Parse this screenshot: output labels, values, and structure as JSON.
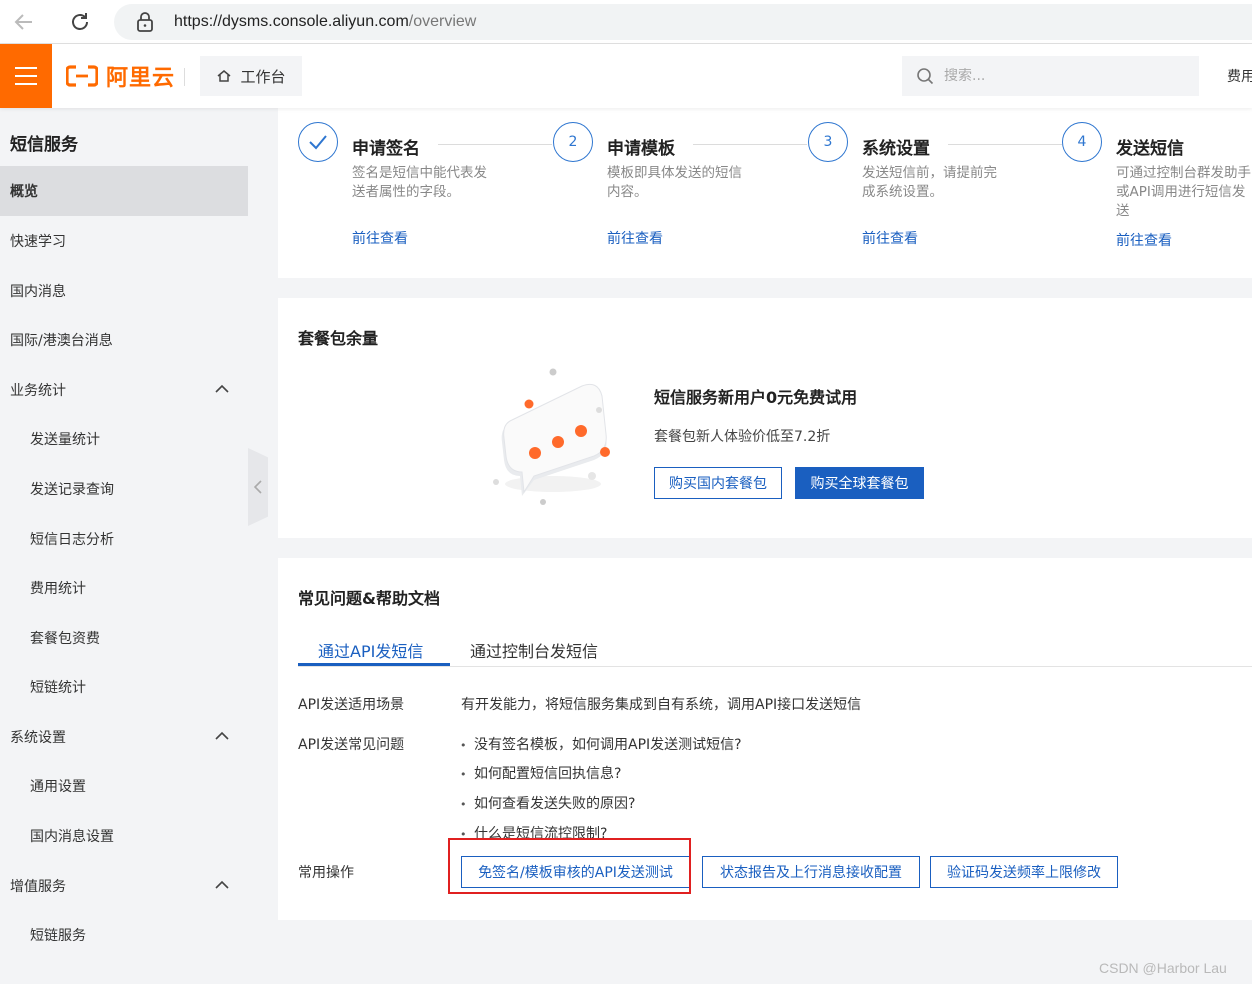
{
  "browser": {
    "url_host": "https://dysms.console.aliyun.com",
    "url_path": "/overview"
  },
  "header": {
    "logo_text": "阿里云",
    "workbench_label": "工作台",
    "search_placeholder": "搜索...",
    "fee_label": "费用"
  },
  "sidebar": {
    "title": "短信服务",
    "items": [
      {
        "label": "概览",
        "active": true
      },
      {
        "label": "快速学习"
      },
      {
        "label": "国内消息"
      },
      {
        "label": "国际/港澳台消息"
      },
      {
        "label": "业务统计",
        "expandable": true
      },
      {
        "label": "发送量统计",
        "sub": true
      },
      {
        "label": "发送记录查询",
        "sub": true
      },
      {
        "label": "短信日志分析",
        "sub": true
      },
      {
        "label": "费用统计",
        "sub": true
      },
      {
        "label": "套餐包资费",
        "sub": true
      },
      {
        "label": "短链统计",
        "sub": true
      },
      {
        "label": "系统设置",
        "expandable": true
      },
      {
        "label": "通用设置",
        "sub": true
      },
      {
        "label": "国内消息设置",
        "sub": true
      },
      {
        "label": "增值服务",
        "expandable": true
      },
      {
        "label": "短链服务",
        "sub": true
      }
    ]
  },
  "steps": [
    {
      "number": "",
      "done": true,
      "title": "申请签名",
      "desc": "签名是短信中能代表发送者属性的字段。",
      "link": "前往查看"
    },
    {
      "number": "2",
      "title": "申请模板",
      "desc": "模板即具体发送的短信内容。",
      "link": "前往查看"
    },
    {
      "number": "3",
      "title": "系统设置",
      "desc": "发送短信前，请提前完成系统设置。",
      "link": "前往查看"
    },
    {
      "number": "4",
      "title": "发送短信",
      "desc": "可通过控制台群发助手或API调用进行短信发送",
      "link": "前往查看"
    }
  ],
  "package": {
    "title": "套餐包余量",
    "headline": "短信服务新用户0元免费试用",
    "subtext": "套餐包新人体验价低至7.2折",
    "btn_domestic": "购买国内套餐包",
    "btn_global": "购买全球套餐包"
  },
  "faq": {
    "title": "常见问题&帮助文档",
    "tabs": [
      "通过API发短信",
      "通过控制台发短信"
    ],
    "scene_label": "API发送适用场景",
    "scene_value": "有开发能力，将短信服务集成到自有系统，调用API接口发送短信",
    "faq_label": "API发送常见问题",
    "questions": [
      "没有签名模板，如何调用API发送测试短信?",
      "如何配置短信回执信息?",
      "如何查看发送失败的原因?",
      "什么是短信流控限制?"
    ],
    "ops_label": "常用操作",
    "ops": [
      "免签名/模板审核的API发送测试",
      "状态报告及上行消息接收配置",
      "验证码发送频率上限修改"
    ]
  },
  "watermark": "CSDN @Harbor Lau",
  "colors": {
    "accent": "#ff6a00",
    "link": "#1a5fc0",
    "highlight": "#e02020"
  }
}
